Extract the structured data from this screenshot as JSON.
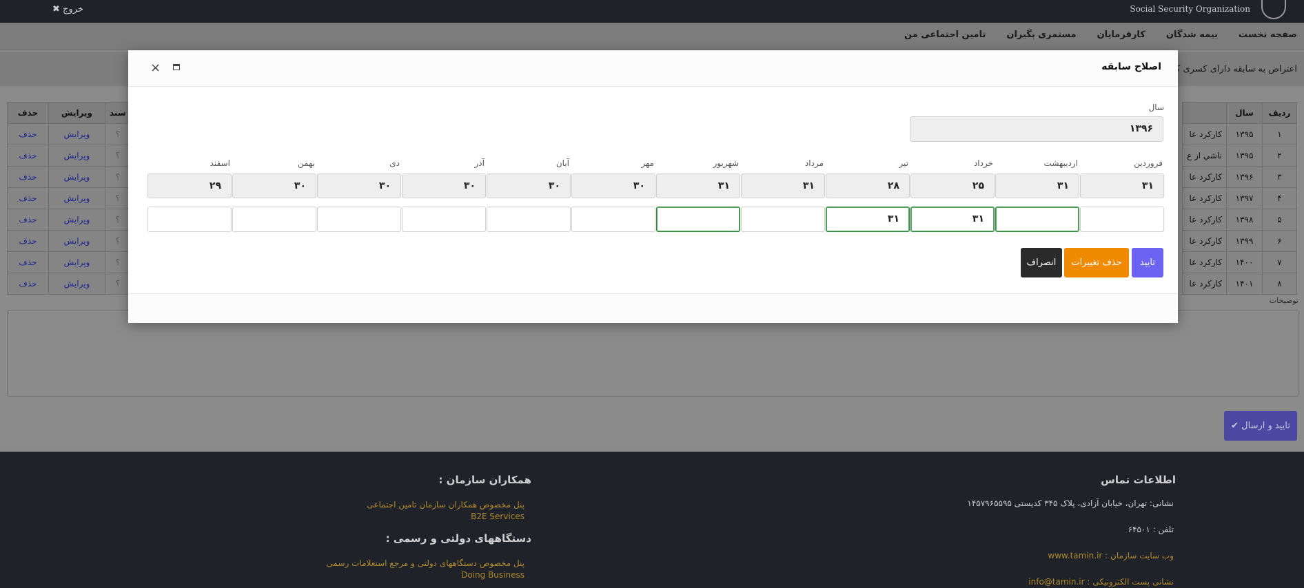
{
  "topbar": {
    "logout_label": "✖ خروج",
    "org_name": "Social Security Organization"
  },
  "nav": {
    "items": [
      "صفحه نخست",
      "بیمه شدگان",
      "کارفرمایان",
      "مستمری بگیران",
      "تامین اجتماعی من"
    ]
  },
  "subbar": {
    "text": "اعتراض به سابقه دارای کسری کارکرد"
  },
  "left_table": {
    "headers": [
      "حذف",
      "ویرایش",
      "سند"
    ],
    "rows": [
      {
        "delete": "حذف",
        "edit": "ویرایش",
        "q": "؟"
      },
      {
        "delete": "حذف",
        "edit": "ویرایش",
        "q": "؟"
      },
      {
        "delete": "حذف",
        "edit": "ویرایش",
        "q": "؟"
      },
      {
        "delete": "حذف",
        "edit": "ویرایش",
        "q": "؟"
      },
      {
        "delete": "حذف",
        "edit": "ویرایش",
        "q": "؟"
      },
      {
        "delete": "حذف",
        "edit": "ویرایش",
        "q": "؟"
      },
      {
        "delete": "حذف",
        "edit": "ویرایش",
        "q": "؟"
      },
      {
        "delete": "حذف",
        "edit": "ویرایش",
        "q": "؟"
      }
    ]
  },
  "right_table": {
    "headers": [
      "ردیف",
      "سال"
    ],
    "rows": [
      {
        "idx": "۱",
        "year": "۱۳۹۵",
        "desc": "کارکرد عا"
      },
      {
        "idx": "۲",
        "year": "۱۳۹۵",
        "desc": "ناشي از ع"
      },
      {
        "idx": "۳",
        "year": "۱۳۹۶",
        "desc": "کارکرد عا"
      },
      {
        "idx": "۴",
        "year": "۱۳۹۷",
        "desc": "کارکرد عا"
      },
      {
        "idx": "۵",
        "year": "۱۳۹۸",
        "desc": "کارکرد عا"
      },
      {
        "idx": "۶",
        "year": "۱۳۹۹",
        "desc": "کارکرد عا"
      },
      {
        "idx": "۷",
        "year": "۱۴۰۰",
        "desc": "کارکرد عا"
      },
      {
        "idx": "۸",
        "year": "۱۴۰۱",
        "desc": "کارکرد عا"
      }
    ]
  },
  "notes_label": "توضیحات",
  "submit_label": "✔ تایید و ارسال",
  "modal": {
    "title": "اصلاح سابقه",
    "close_glyph": "×",
    "year_label": "سال",
    "year_value": "۱۳۹۶",
    "months": [
      {
        "name": "فروردین",
        "days": "۳۱",
        "value": "",
        "active": false
      },
      {
        "name": "اردیبهشت",
        "days": "۳۱",
        "value": "",
        "active": true
      },
      {
        "name": "خرداد",
        "days": "۲۵",
        "value": "۳۱",
        "active": true
      },
      {
        "name": "تیر",
        "days": "۲۸",
        "value": "۳۱",
        "active": true
      },
      {
        "name": "مرداد",
        "days": "۳۱",
        "value": "",
        "active": false
      },
      {
        "name": "شهریور",
        "days": "۳۱",
        "value": "",
        "active": true
      },
      {
        "name": "مهر",
        "days": "۳۰",
        "value": "",
        "active": false
      },
      {
        "name": "آبان",
        "days": "۳۰",
        "value": "",
        "active": false
      },
      {
        "name": "آذر",
        "days": "۳۰",
        "value": "",
        "active": false
      },
      {
        "name": "دی",
        "days": "۳۰",
        "value": "",
        "active": false
      },
      {
        "name": "بهمن",
        "days": "۳۰",
        "value": "",
        "active": false
      },
      {
        "name": "اسفند",
        "days": "۲۹",
        "value": "",
        "active": false
      }
    ],
    "confirm_label": "تایید",
    "discard_label": "حذف تغییرات",
    "cancel_label": "انصراف"
  },
  "footer": {
    "contact_title": "اطلاعات تماس",
    "address": "نشانی: تهران، خیابان آزادی، پلاک ۳۴۵ کدپستی ۱۴۵۷۹۶۵۵۹۵",
    "phone": "تلفن : ۶۴۵۰۱",
    "website": "وب سایت سازمان : www.tamin.ir",
    "email": "نشانی پست الکترونیکی : info@tamin.ir",
    "partners_title": "همکاران سازمان :",
    "partners_line1": "پنل مخصوص همکاران سازمان تامین اجتماعی",
    "partners_line2": "B2E Services",
    "gov_title": "دستگاههای دولتی و رسمی :",
    "gov_line1": "پنل مخصوص دستگاههای دولتی و مرجع استعلامات رسمی",
    "gov_line2": "Doing Business"
  },
  "colors": {
    "confirm": "#6c63f2",
    "discard": "#f08a00",
    "cancel": "#2a2a2a",
    "active_border": "#2e8b3e",
    "footer_link": "#b08a2e"
  }
}
